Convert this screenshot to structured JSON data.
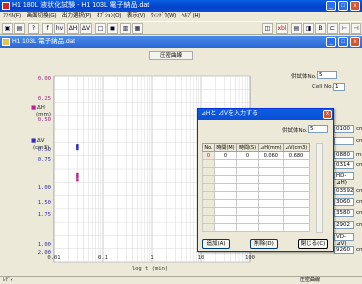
{
  "window": {
    "title": "H1 180L 液状化試験 - H1 103L 電子納品.dat",
    "min": "_",
    "max": "□",
    "close": "x"
  },
  "menu": [
    "ﾌｧｲﾙ(F)",
    "画面切換(G)",
    "出力選択(P)",
    "ｵﾌﾟｼｮﾝ(O)",
    "表示(V)",
    "ｳｨﾝﾄﾞｳ(W)",
    "ﾍﾙﾌﾟ(H)"
  ],
  "toolbar": {
    "buttons": [
      "▣",
      "▤",
      "?",
      "f",
      "hv",
      "ΔH",
      "ΔV",
      "□",
      "◼",
      "▥",
      "▦"
    ],
    "right_buttons": [
      "◫",
      "xbl",
      "▤",
      "◨",
      "B",
      "⊏",
      "⊢",
      "⊣"
    ]
  },
  "mdi": {
    "title": "H1 103L 電子納品.dat"
  },
  "chart_title": "圧密曲線",
  "chart_data": {
    "type": "scatter",
    "xlabel": "log t (min)",
    "x_ticks": [
      "0.01",
      "0.1",
      "1",
      "10",
      "100"
    ],
    "upper_panel": {
      "label": "ΔH",
      "unit": "(mm)",
      "y_ticks": [
        "0.00",
        "0.25",
        "0.50"
      ]
    },
    "lower_panel": {
      "label": "ΔV",
      "unit": "(cm3)",
      "y_ticks": [
        "0.50",
        "0.75",
        "1.00",
        "1.50",
        "1.75",
        "1.00",
        "2.00"
      ]
    },
    "points_upper": [
      {
        "x": 0.03,
        "y": 0.5
      },
      {
        "x": 0.03,
        "y": 0.54
      },
      {
        "x": 0.03,
        "y": 0.58
      }
    ],
    "points_lower": [
      {
        "x": 0.03,
        "y": 0.52
      },
      {
        "x": 0.03,
        "y": 0.58
      },
      {
        "x": 0.03,
        "y": 0.66
      }
    ],
    "legend_colors": {
      "dH": "#c0209a",
      "dV": "#3030c0"
    }
  },
  "side": {
    "stage_label": "供試体No.",
    "stage_value": "5",
    "cell_label": "Cell No.",
    "cell_value": "1",
    "rows": [
      {
        "value": "0100",
        "unit": "cm"
      },
      {
        "value": "",
        "unit": "cm"
      },
      {
        "value": "0880",
        "unit": "mm"
      },
      {
        "value": "0314",
        "unit": "cm"
      },
      {
        "value": "HD-⊿H)",
        "unit": ""
      },
      {
        "value": "03592",
        "unit": "cm3"
      },
      {
        "value": "3060",
        "unit": "cm3"
      },
      {
        "value": "3580",
        "unit": "cm3"
      },
      {
        "value": "2902",
        "unit": "cm3"
      },
      {
        "value": "VD-⊿V)",
        "unit": ""
      },
      {
        "value": "9260",
        "unit": "cm2"
      }
    ]
  },
  "dialog": {
    "title": "⊿Hと ⊿Vを入力する",
    "stage_label": "供試体No.",
    "stage_value": "5",
    "columns": [
      "No.",
      "時間(M)",
      "時間(S)",
      "⊿H(mm)",
      "⊿V(cm3)"
    ],
    "rows": [
      [
        "0",
        "0",
        "0",
        "0.060",
        "0.680"
      ],
      [
        "",
        "",
        "",
        "",
        ""
      ],
      [
        "",
        "",
        "",
        "",
        ""
      ],
      [
        "",
        "",
        "",
        "",
        ""
      ],
      [
        "",
        "",
        "",
        "",
        ""
      ],
      [
        "",
        "",
        "",
        "",
        ""
      ],
      [
        "",
        "",
        "",
        "",
        ""
      ],
      [
        "",
        "",
        "",
        "",
        ""
      ],
      [
        "",
        "",
        "",
        "",
        ""
      ],
      [
        "",
        "",
        "",
        "",
        ""
      ]
    ],
    "buttons": {
      "add": "追加(A)",
      "delete": "削除(D)",
      "close": "閉じる(C)"
    }
  },
  "status": {
    "left": "ﾚﾃﾞｨ",
    "right": "圧密曲線"
  }
}
